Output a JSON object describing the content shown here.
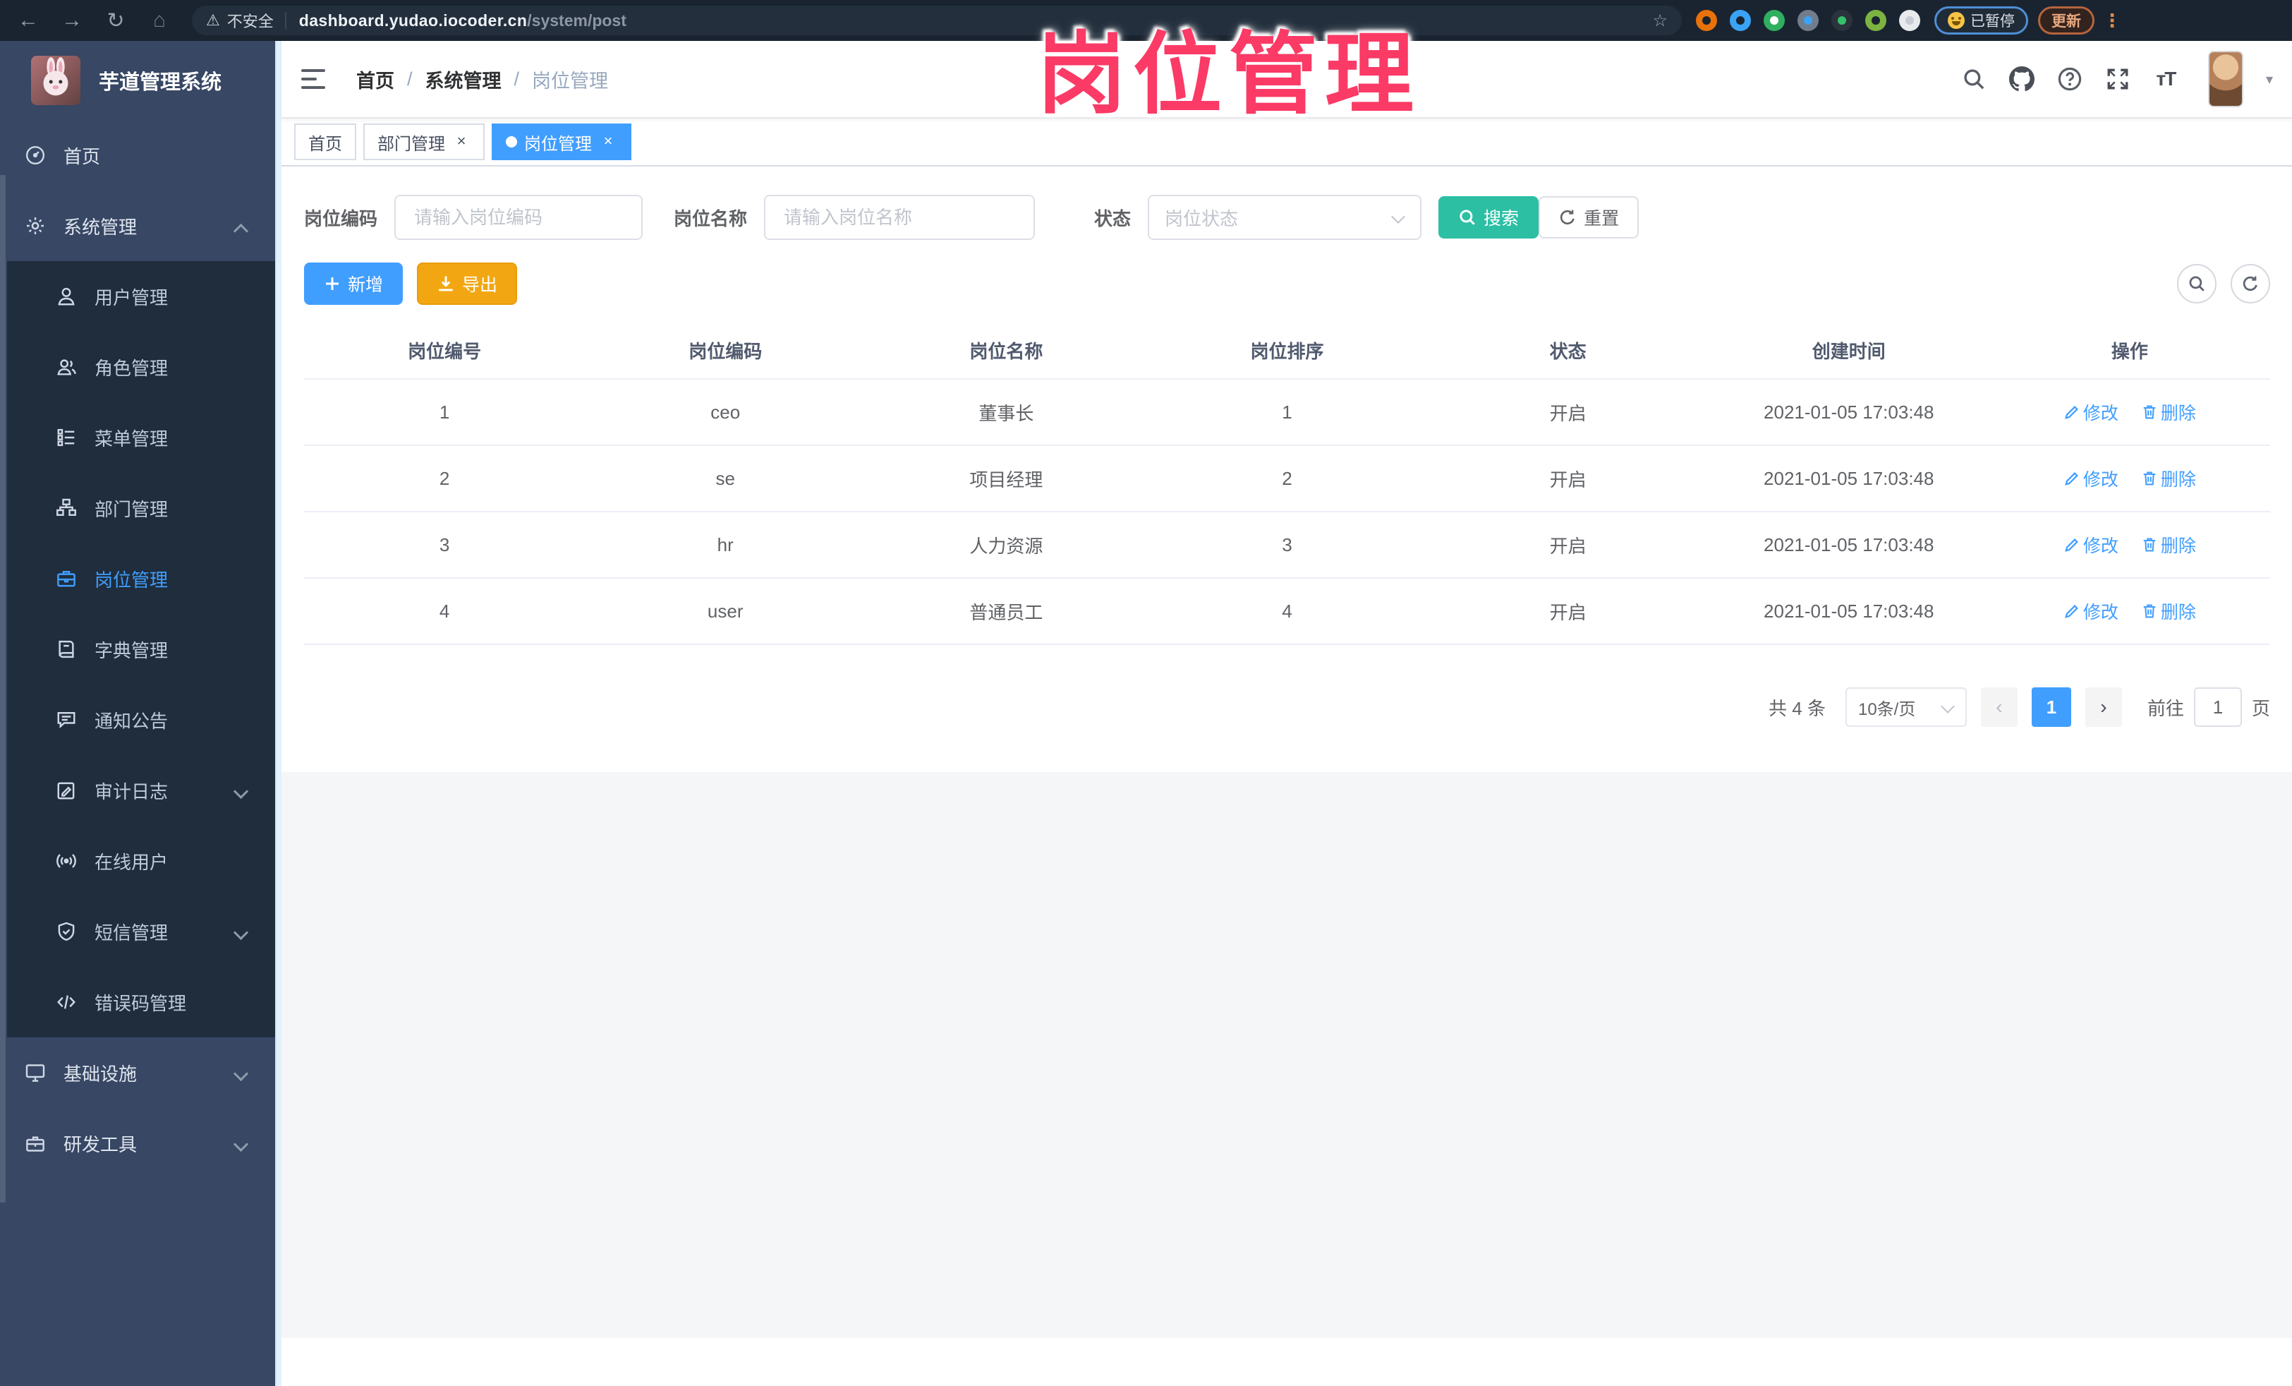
{
  "browser": {
    "icons": {
      "back": "←",
      "forward": "→",
      "reload": "↻",
      "home": "⌂",
      "warning": "⚠",
      "star": "☆",
      "menu_dots": "⋮"
    },
    "security_label": "不安全",
    "url_host": "dashboard.yudao.iocoder.cn",
    "url_path": "/system/post",
    "paused_label": "已暂停",
    "update_label": "更新",
    "extensions": [
      {
        "name": "ext-orange-ring-icon",
        "color": "#e8710a",
        "inner": "#1a2430"
      },
      {
        "name": "ext-location-pin-icon",
        "color": "#3aa3f5",
        "inner": "#1a2430"
      },
      {
        "name": "ext-green-check-icon",
        "color": "#2faf5f",
        "inner": "#ffffff"
      },
      {
        "name": "ext-grid-blue-icon",
        "color": "#717d8c",
        "inner": "#3aa3f5"
      },
      {
        "name": "ext-dark-badge-icon",
        "color": "#2b333d",
        "inner": "#35c06a"
      },
      {
        "name": "ext-sprout-icon",
        "color": "#7cb342",
        "inner": "#1a2430"
      },
      {
        "name": "ext-puzzle-icon",
        "color": "#e8eaed",
        "inner": "#c7ccd4"
      }
    ]
  },
  "watermark": {
    "text": "岗位管理",
    "color": "#fb3a66"
  },
  "sidebar": {
    "app_title": "芋道管理系统",
    "items": [
      {
        "label": "首页",
        "icon": "dashboard-icon",
        "type": "top"
      },
      {
        "label": "系统管理",
        "icon": "gear-icon",
        "type": "top",
        "caret": "up"
      },
      {
        "label": "用户管理",
        "icon": "user-icon",
        "type": "sub"
      },
      {
        "label": "角色管理",
        "icon": "role-icon",
        "type": "sub"
      },
      {
        "label": "菜单管理",
        "icon": "menu-list-icon",
        "type": "sub"
      },
      {
        "label": "部门管理",
        "icon": "org-tree-icon",
        "type": "sub"
      },
      {
        "label": "岗位管理",
        "icon": "briefcase-icon",
        "type": "sub",
        "active": true
      },
      {
        "label": "字典管理",
        "icon": "dictionary-icon",
        "type": "sub"
      },
      {
        "label": "通知公告",
        "icon": "announcement-icon",
        "type": "sub"
      },
      {
        "label": "审计日志",
        "icon": "audit-log-icon",
        "type": "sub",
        "caret": "down"
      },
      {
        "label": "在线用户",
        "icon": "online-user-icon",
        "type": "sub"
      },
      {
        "label": "短信管理",
        "icon": "sms-shield-icon",
        "type": "sub",
        "caret": "down"
      },
      {
        "label": "错误码管理",
        "icon": "error-code-icon",
        "type": "sub"
      },
      {
        "label": "基础设施",
        "icon": "infrastructure-icon",
        "type": "top",
        "caret": "down"
      },
      {
        "label": "研发工具",
        "icon": "dev-tools-icon",
        "type": "top",
        "caret": "down"
      }
    ]
  },
  "header": {
    "breadcrumb": [
      "首页",
      "系统管理",
      "岗位管理"
    ],
    "separator": "/",
    "fontsize_icon_text": "ᴛT",
    "caret_icon": "▾"
  },
  "tabs": [
    {
      "label": "首页",
      "closable": false,
      "active": false
    },
    {
      "label": "部门管理",
      "closable": true,
      "active": false
    },
    {
      "label": "岗位管理",
      "closable": true,
      "active": true
    }
  ],
  "tab_close_icon": "×",
  "filter": {
    "code_label": "岗位编码",
    "code_placeholder": "请输入岗位编码",
    "name_label": "岗位名称",
    "name_placeholder": "请输入岗位名称",
    "status_label": "状态",
    "status_placeholder": "岗位状态",
    "search_label": "搜索",
    "reset_label": "重置"
  },
  "toolbar": {
    "add_label": "新增",
    "export_label": "导出"
  },
  "table": {
    "headers": [
      "岗位编号",
      "岗位编码",
      "岗位名称",
      "岗位排序",
      "状态",
      "创建时间",
      "操作"
    ],
    "rows": [
      {
        "id": "1",
        "code": "ceo",
        "name": "董事长",
        "sort": "1",
        "status": "开启",
        "create_time": "2021-01-05 17:03:48"
      },
      {
        "id": "2",
        "code": "se",
        "name": "项目经理",
        "sort": "2",
        "status": "开启",
        "create_time": "2021-01-05 17:03:48"
      },
      {
        "id": "3",
        "code": "hr",
        "name": "人力资源",
        "sort": "3",
        "status": "开启",
        "create_time": "2021-01-05 17:03:48"
      },
      {
        "id": "4",
        "code": "user",
        "name": "普通员工",
        "sort": "4",
        "status": "开启",
        "create_time": "2021-01-05 17:03:48"
      }
    ],
    "action_edit": "修改",
    "action_delete": "删除"
  },
  "pagination": {
    "total": "共 4 条",
    "page_size": "10条/页",
    "prev_icon": "‹",
    "next_icon": "›",
    "current_page": "1",
    "goto_prefix": "前往",
    "goto_value": "1",
    "goto_suffix": "页"
  },
  "colors": {
    "primary": "#409eff",
    "search_green": "#2cbfa4",
    "export_orange": "#f2a712",
    "sidebar": "#374764",
    "submenu": "#1f2d3d"
  }
}
